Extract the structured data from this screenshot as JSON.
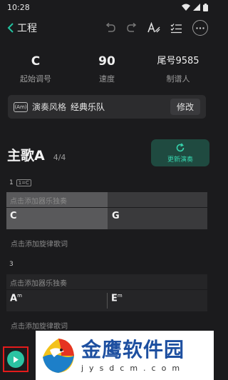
{
  "status": {
    "time": "10:28"
  },
  "nav": {
    "back_label": "工程"
  },
  "info": [
    {
      "value": "C",
      "label": "起始调号"
    },
    {
      "value": "90",
      "label": "速度"
    },
    {
      "value": "尾号9585",
      "label": "制谱人"
    }
  ],
  "style": {
    "icon_text": "(Am)",
    "label": "演奏风格",
    "value": "经典乐队",
    "edit_label": "修改"
  },
  "section": {
    "name": "主歌A",
    "count": "4/4",
    "refresh_label": "更新演奏"
  },
  "bars": [
    {
      "number": "1",
      "chord_tag": "1=C",
      "solo_hint": "点击添加器乐独奏",
      "chords": [
        "C",
        "G"
      ]
    },
    {
      "number": "3",
      "solo_hint": "点击添加器乐独奏",
      "chords": [
        "A",
        "E"
      ],
      "chord_suffixes": [
        "m",
        "m"
      ]
    }
  ],
  "lyric_hint": "点击添加旋律歌词",
  "watermark": {
    "title": "金鹰软件园",
    "subtitle": "jysdcm.com"
  },
  "colors": {
    "accent": "#2bc3a2",
    "background": "#1b1b1d",
    "watermark_blue": "#1d4fa0"
  }
}
